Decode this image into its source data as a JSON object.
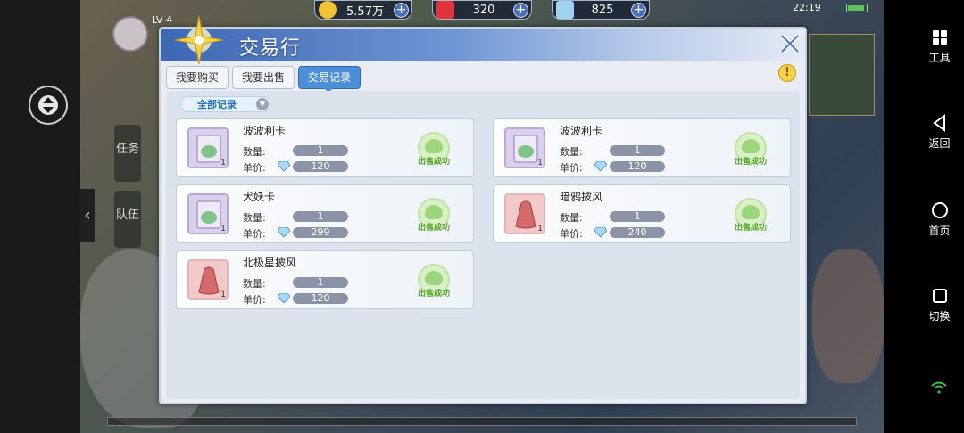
{
  "status": {
    "time": "22:19"
  },
  "hud": {
    "level": "LV 4",
    "currencies": [
      {
        "id": "gold",
        "value": "5.57万",
        "color": "#f1c232"
      },
      {
        "id": "ruby",
        "value": "320",
        "color": "#e2353b"
      },
      {
        "id": "crystal",
        "value": "825",
        "color": "#9fd3f0"
      }
    ],
    "side_buttons": [
      "任务",
      "队伍"
    ],
    "plus": "+"
  },
  "dialog": {
    "title": "交易行",
    "tabs": [
      {
        "label": "我要购买",
        "active": false
      },
      {
        "label": "我要出售",
        "active": false
      },
      {
        "label": "交易记录",
        "active": true
      }
    ],
    "filter": {
      "label": "全部记录"
    },
    "warn": "!",
    "labels": {
      "qty": "数量:",
      "price": "单价:",
      "status": "出售成功"
    },
    "records": [
      {
        "name": "波波利卡",
        "qty": "1",
        "price": "120",
        "thumb_qty": "1",
        "thumb": "card"
      },
      {
        "name": "波波利卡",
        "qty": "1",
        "price": "120",
        "thumb_qty": "1",
        "thumb": "card"
      },
      {
        "name": "犬妖卡",
        "qty": "1",
        "price": "299",
        "thumb_qty": "1",
        "thumb": "card"
      },
      {
        "name": "暗鸦披风",
        "qty": "1",
        "price": "240",
        "thumb_qty": "1",
        "thumb": "cape"
      },
      {
        "name": "北极星披风",
        "qty": "1",
        "price": "120",
        "thumb_qty": "1",
        "thumb": "cape"
      }
    ]
  },
  "nav": [
    {
      "label": "工具",
      "icon": "grid-icon"
    },
    {
      "label": "返回",
      "icon": "back-icon"
    },
    {
      "label": "首页",
      "icon": "home-icon"
    },
    {
      "label": "切换",
      "icon": "switch-icon"
    }
  ]
}
